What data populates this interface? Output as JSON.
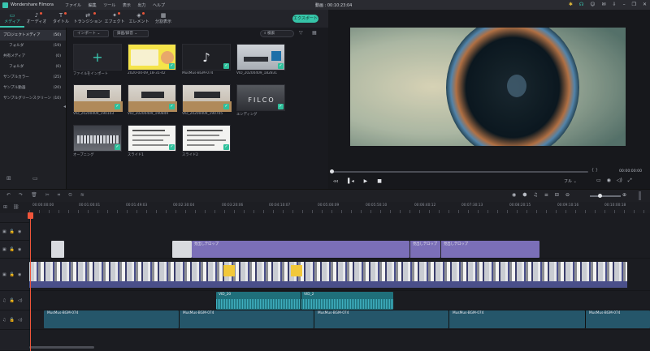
{
  "titlebar": {
    "app": "Wondershare Filmora",
    "menu": [
      "ファイル",
      "編集",
      "ツール",
      "表示",
      "出力",
      "ヘルプ"
    ],
    "center": "動画 : 00:10:23:04"
  },
  "tabs": [
    {
      "label": "メディア",
      "icon": "folder-icon"
    },
    {
      "label": "オーディオ",
      "icon": "music-icon"
    },
    {
      "label": "タイトル",
      "icon": "text-icon"
    },
    {
      "label": "トランジション",
      "icon": "transition-icon"
    },
    {
      "label": "エフェクト",
      "icon": "effect-icon"
    },
    {
      "label": "エレメント",
      "icon": "element-icon"
    },
    {
      "label": "分割表示",
      "icon": "split-icon"
    }
  ],
  "export_label": "エクスポート",
  "left_panel": [
    {
      "label": "プロジェクトメディア",
      "count": "(50)",
      "sub": false,
      "sel": true
    },
    {
      "label": "フォルダ",
      "count": "(19)",
      "sub": true,
      "sel": false
    },
    {
      "label": "共有メディア",
      "count": "(0)",
      "sub": false,
      "sel": false
    },
    {
      "label": "フォルダ",
      "count": "(0)",
      "sub": true,
      "sel": false
    },
    {
      "label": "サンプルカラー",
      "count": "(25)",
      "sub": false,
      "sel": false
    },
    {
      "label": "サンプル動画",
      "count": "(20)",
      "sub": false,
      "sel": false
    },
    {
      "label": "サンプルグリーンスクリーン",
      "count": "(10)",
      "sub": false,
      "sel": false
    }
  ],
  "media_toolbar": {
    "import": "インポート",
    "record": "録画/録音",
    "search_placeholder": "検索"
  },
  "media_tiles": [
    {
      "cap": "ファイルをインポート",
      "kind": "import"
    },
    {
      "cap": "2020-04-09_18-31-42",
      "kind": "yellow"
    },
    {
      "cap": "MusMus-BGM-074",
      "kind": "music"
    },
    {
      "cap": "VID_20200409_182831",
      "kind": "desk"
    },
    {
      "cap": "VID_20200409_190103",
      "kind": "desk"
    },
    {
      "cap": "VID_20200409_190849",
      "kind": "desk"
    },
    {
      "cap": "VID_20200409_190705",
      "kind": "desk"
    },
    {
      "cap": "エンディング",
      "kind": "filco"
    },
    {
      "cap": "オープニング",
      "kind": "keyboard"
    },
    {
      "cap": "スライド1",
      "kind": "slide"
    },
    {
      "cap": "スライド2",
      "kind": "slide"
    }
  ],
  "filco_text": "FILCO",
  "player": {
    "time": "00:00:00:00",
    "zoom": "フル",
    "brackets": "{   }"
  },
  "ruler": [
    "00:00:00:00",
    "00:01:00:01",
    "00:01:49:03",
    "00:02:30:04",
    "00:03:20:06",
    "00:04:10:07",
    "00:05:00:09",
    "00:05:50:10",
    "00:06:40:12",
    "00:07:30:13",
    "00:08:20:15",
    "00:09:10:16",
    "00:10:00:18"
  ],
  "tracks": {
    "title_clips": [
      "見出しテロップ",
      "見出しテロップ",
      "見出しテロップ"
    ],
    "audio_clip_labels": [
      "VID_20",
      "VID_2"
    ],
    "bgm_labels": [
      "MusMus-BGM-074",
      "MusMus-BGM-074",
      "MusMus-BGM-074",
      "MusMus-BGM-074",
      "MusMus-BGM-074"
    ]
  },
  "colors": {
    "accent": "#39c6b0",
    "export": "#36c4a8",
    "playhead": "#f0553a",
    "title_clip": "#7b6fb8",
    "video_clip": "#4a4f8a",
    "audio_clip": "#1f6f7a",
    "bgm_clip": "#25566a"
  }
}
